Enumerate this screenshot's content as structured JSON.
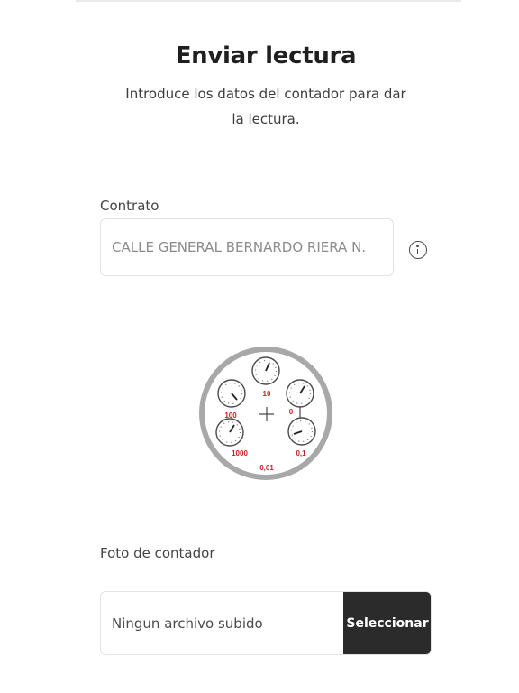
{
  "header": {
    "title": "Enviar lectura",
    "subtitle_line1": "Introduce los datos del contador para dar",
    "subtitle_line2": "la lectura."
  },
  "contract": {
    "label": "Contrato",
    "value": "CALLE GENERAL BERNARDO RIERA N.",
    "info_icon": "info-icon"
  },
  "meter_illustration": {
    "dial_labels": [
      "10",
      "100",
      "0",
      "1000",
      "0,1",
      "0,01"
    ],
    "outline_color": "#a8a8a8",
    "label_color": "#cc2027"
  },
  "photo": {
    "label": "Foto de contador",
    "status": "Ningun archivo subido",
    "button_label": "Seleccionar"
  }
}
